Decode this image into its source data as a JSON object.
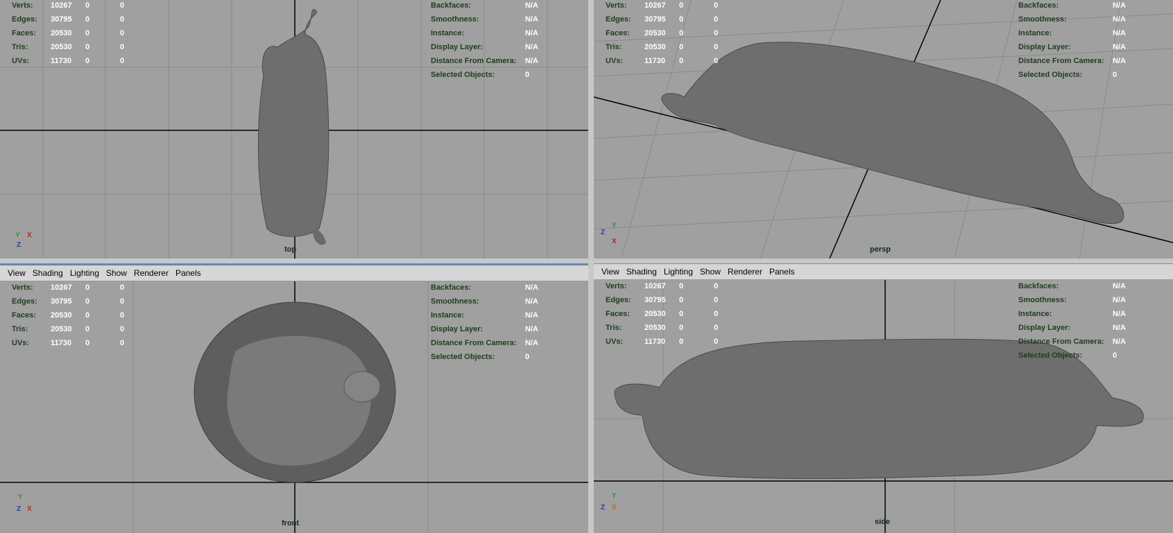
{
  "menu": [
    "View",
    "Shading",
    "Lighting",
    "Show",
    "Renderer",
    "Panels"
  ],
  "stats_labels": [
    "Verts:",
    "Edges:",
    "Faces:",
    "Tris:",
    "UVs:"
  ],
  "stats_values": [
    [
      "10267",
      "0",
      "0"
    ],
    [
      "30795",
      "0",
      "0"
    ],
    [
      "20530",
      "0",
      "0"
    ],
    [
      "20530",
      "0",
      "0"
    ],
    [
      "11730",
      "0",
      "0"
    ]
  ],
  "info_labels": [
    "Backfaces:",
    "Smoothness:",
    "Instance:",
    "Display Layer:",
    "Distance From Camera:",
    "Selected Objects:"
  ],
  "info_values": [
    "N/A",
    "N/A",
    "N/A",
    "N/A",
    "N/A",
    "0"
  ],
  "viewports": {
    "top": {
      "camera": "top"
    },
    "persp": {
      "camera": "persp"
    },
    "front": {
      "camera": "front"
    },
    "side": {
      "camera": "side"
    }
  },
  "axes": {
    "top": [
      "Y",
      "X",
      "Z"
    ],
    "persp": [
      "Y",
      "X",
      "Z"
    ],
    "front": [
      "Y",
      "X",
      "Z"
    ],
    "side": [
      "Y",
      "Z",
      "X"
    ]
  },
  "colors": {
    "viewport_bg": "#a0a0a0",
    "hud_label": "#1d3d1d",
    "hud_value": "#ffffff",
    "active_border": "#5f88b8",
    "mesh": "#6e6e6e"
  }
}
